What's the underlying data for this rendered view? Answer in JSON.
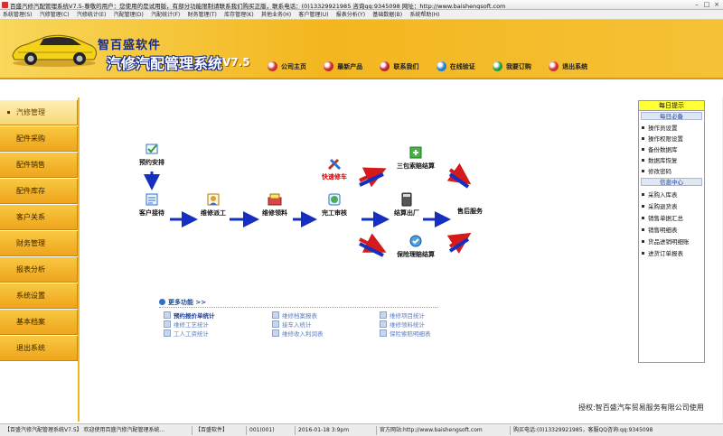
{
  "window": {
    "title": "百盛汽修汽配管理系统V7.5-尊敬的用户：您使用的是试用版，有部分功能限制请联系我们购买正版，联系电话：(0)13329921985  咨询qq:9345098    网址：http://www.baishengsoft.com"
  },
  "menu": [
    "系统管理(S)",
    "汽修管理(C)",
    "汽修统计(E)",
    "汽配管理(D)",
    "汽配统计(F)",
    "财务管理(T)",
    "库存管理(K)",
    "其他业务(H)",
    "客户管理(U)",
    "报表分析(Y)",
    "基础数据(B)",
    "系统帮助(H)"
  ],
  "banner": {
    "logo_top": "智百盛软件",
    "logo_main": "汽修汽配管理系统",
    "logo_version": "V7.5",
    "nav": [
      {
        "label": "公司主页",
        "icon": "home-icon",
        "color": "#d0302a"
      },
      {
        "label": "最新产品",
        "icon": "new-product-icon",
        "color": "#c62a2a"
      },
      {
        "label": "联系我们",
        "icon": "contact-icon",
        "color": "#c02030"
      },
      {
        "label": "在线验证",
        "icon": "verify-icon",
        "color": "#2a7ad0"
      },
      {
        "label": "我要订购",
        "icon": "order-icon",
        "color": "#2a9a3a"
      },
      {
        "label": "退出系统",
        "icon": "exit-icon",
        "color": "#cc3030"
      }
    ]
  },
  "sidebar": [
    "汽修管理",
    "配件采购",
    "配件销售",
    "配件库存",
    "客户关系",
    "财务管理",
    "报表分析",
    "系统设置",
    "基本档案",
    "退出系统"
  ],
  "flow": {
    "nodes": {
      "yuyue": "预约安排",
      "kehu": "客户接待",
      "weixiu": "维修派工",
      "lingliao": "维修领料",
      "wangong": "完工审核",
      "kuaisu": "快速修车",
      "sanfang": "三包索赔结算",
      "jiesuan": "结算出厂",
      "baoxian": "保险理赔结算",
      "shouhou": "售后服务"
    }
  },
  "func_panel": {
    "header": "更多功能 >>",
    "links": [
      [
        "预约报价单统计",
        "维修工艺统计",
        "工人工资统计"
      ],
      [
        "维修档案报表",
        "接车入统计",
        "维修收入利润表"
      ],
      [
        "维修项目统计",
        "维修领料统计",
        "保险索赔明细表"
      ]
    ]
  },
  "tips": {
    "title": "每日提示",
    "sec1": "每日必备",
    "items1": [
      "操作员设置",
      "操作权限设置",
      "备份数据库",
      "数据库恢复",
      "修改密码"
    ],
    "sec2": "信息中心",
    "items2": [
      "采购入库表",
      "采购退货表",
      "销售单据汇总",
      "销售明细表",
      "货品进销明细账",
      "进货订单报表"
    ]
  },
  "credit": "授权:智百盛汽车贸易服务有限公司使用",
  "statusbar": {
    "app": "【百盛汽修汽配管理系统V7.5】 欢迎使用百盛汽修汽配管理系统...",
    "company": "【百盛软件】",
    "user": "001(001)",
    "datetime": "2016-01-18 3:9pm",
    "site": "官方网站:http://www.baishengsoft.com",
    "phone": "购买电话:(0)13329921985，客服QQ咨询:qq:9345098"
  }
}
